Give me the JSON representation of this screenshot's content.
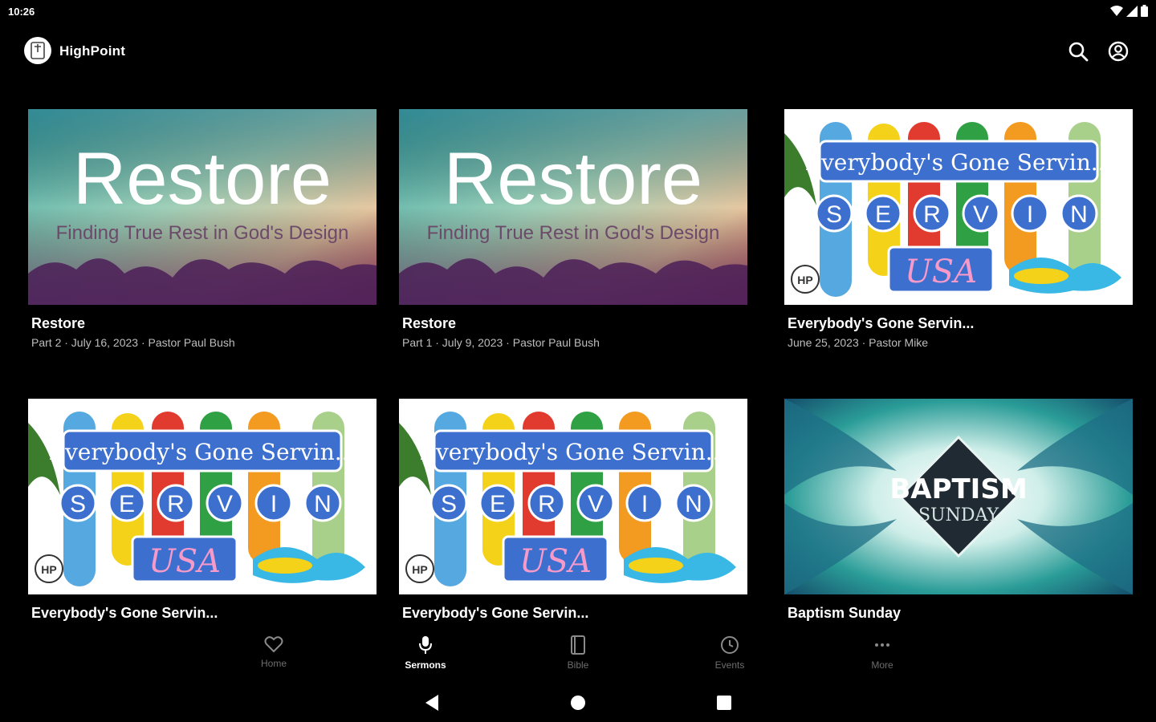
{
  "status_bar": {
    "time": "10:26",
    "icons": [
      "wifi-icon",
      "signal-icon",
      "battery-icon"
    ]
  },
  "app_bar": {
    "title": "HighPoint",
    "logo_icon": "bible-logo-icon",
    "actions": [
      {
        "name": "search",
        "icon": "search-icon"
      },
      {
        "name": "account",
        "icon": "account-circle-icon"
      }
    ]
  },
  "sermons": [
    {
      "title": "Restore",
      "subtitle": "Part 2 · July 16, 2023 · Pastor Paul Bush",
      "artwork": {
        "kind": "restore",
        "headline": "Restore",
        "tagline": "Finding True Rest in God's Design"
      }
    },
    {
      "title": "Restore",
      "subtitle": "Part 1 · July 9, 2023 · Pastor Paul Bush",
      "artwork": {
        "kind": "restore",
        "headline": "Restore",
        "tagline": "Finding True Rest in God's Design"
      }
    },
    {
      "title": "Everybody's Gone Servin...",
      "subtitle": "June 25, 2023 · Pastor Mike",
      "artwork": {
        "kind": "servin",
        "banner": "Everybody's Gone Servin...",
        "letters": [
          "S",
          "E",
          "R",
          "V",
          "I",
          "N"
        ],
        "word": "USA",
        "badge": "HP"
      }
    },
    {
      "title": "Everybody's Gone Servin...",
      "subtitle": "",
      "artwork": {
        "kind": "servin",
        "banner": "Everybody's Gone Servin...",
        "letters": [
          "S",
          "E",
          "R",
          "V",
          "I",
          "N"
        ],
        "word": "USA",
        "badge": "HP"
      }
    },
    {
      "title": "Everybody's Gone Servin...",
      "subtitle": "",
      "artwork": {
        "kind": "servin",
        "banner": "Everybody's Gone Servin...",
        "letters": [
          "S",
          "E",
          "R",
          "V",
          "I",
          "N"
        ],
        "word": "USA",
        "badge": "HP"
      }
    },
    {
      "title": "Baptism Sunday",
      "subtitle": "",
      "artwork": {
        "kind": "baptism",
        "headline": "BAPTISM",
        "subhead": "SUNDAY"
      }
    }
  ],
  "bottom_nav": {
    "active": "Sermons",
    "items": [
      {
        "label": "Home",
        "icon": "heart-icon"
      },
      {
        "label": "Sermons",
        "icon": "microphone-icon"
      },
      {
        "label": "Bible",
        "icon": "book-icon"
      },
      {
        "label": "Events",
        "icon": "clock-icon"
      },
      {
        "label": "More",
        "icon": "more-dots-icon"
      }
    ]
  },
  "system_nav": {
    "buttons": [
      "back-icon",
      "home-icon",
      "recents-icon"
    ]
  },
  "colors": {
    "background": "#000000",
    "text_primary": "#ffffff",
    "text_secondary": "#bdbdbd",
    "nav_inactive": "#6d6d6d"
  }
}
